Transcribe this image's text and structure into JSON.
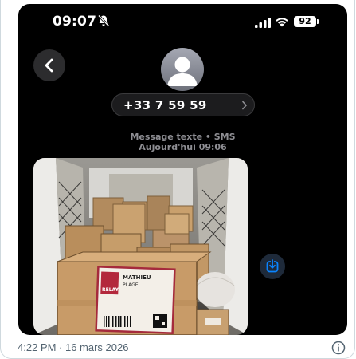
{
  "status_bar": {
    "time": "09:07",
    "battery": "92"
  },
  "contact": {
    "number": "+33 7 59 59"
  },
  "message": {
    "type": "Message texte • SMS",
    "timestamp": "Aujourd'hui 09:06"
  },
  "parcel_label": {
    "brand": "RELAY",
    "name": "MATHIEU",
    "line2": "PLAGE"
  },
  "post": {
    "timestamp": "4:22 PM · 16 mars 2026"
  },
  "colors": {
    "accent": "#0a84ff",
    "phone_bg": "#000000",
    "footer_text": "#536471"
  },
  "icons": [
    "bell-off-icon",
    "signal-icon",
    "wifi-icon",
    "battery-icon",
    "chevron-left-icon",
    "person-icon",
    "chevron-right-icon",
    "download-icon",
    "info-icon"
  ]
}
